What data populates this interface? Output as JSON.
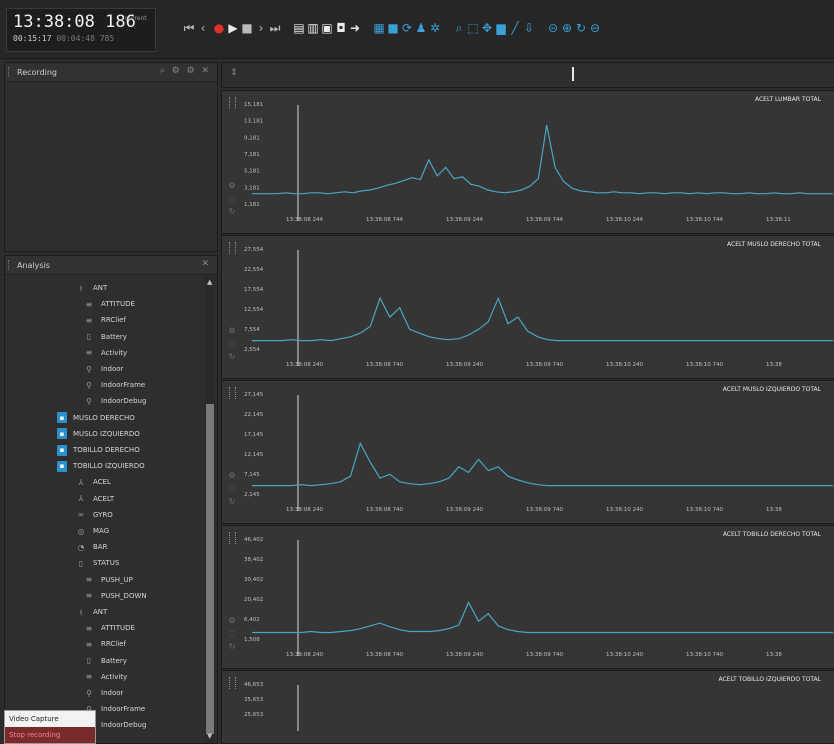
{
  "toolbar": {
    "time_main": "13:38:08 186",
    "time_tag": "current",
    "time_sub": "00:15:17",
    "time_sub_dim": "00:04:48 785",
    "buttons": [
      {
        "name": "skip-start-icon",
        "glyph": "⏮"
      },
      {
        "name": "step-back-icon",
        "glyph": "‹"
      },
      {
        "name": "record-icon",
        "glyph": "●"
      },
      {
        "name": "play-icon",
        "glyph": "▶"
      },
      {
        "name": "stop-icon",
        "glyph": "■"
      },
      {
        "name": "step-forward-icon",
        "glyph": "›"
      },
      {
        "name": "skip-end-icon",
        "glyph": "⏭"
      },
      {
        "name": "page-icon",
        "glyph": "▤"
      },
      {
        "name": "page-copy-icon",
        "glyph": "▥"
      },
      {
        "name": "save-icon",
        "glyph": "▣"
      },
      {
        "name": "camera-icon",
        "glyph": "◘"
      },
      {
        "name": "export-icon",
        "glyph": "➜"
      },
      {
        "name": "grid-icon",
        "glyph": "▦"
      },
      {
        "name": "video-icon",
        "glyph": "■"
      },
      {
        "name": "sync-icon",
        "glyph": "⟳"
      },
      {
        "name": "people-icon",
        "glyph": "♟"
      },
      {
        "name": "settings-icon",
        "glyph": "✲"
      },
      {
        "name": "zoom-icon",
        "glyph": "⌕"
      },
      {
        "name": "select-box-icon",
        "glyph": "⬚"
      },
      {
        "name": "move-icon",
        "glyph": "✥"
      },
      {
        "name": "fill-icon",
        "glyph": "▆"
      },
      {
        "name": "draw-line-icon",
        "glyph": "╱"
      },
      {
        "name": "pin-icon",
        "glyph": "⇩"
      },
      {
        "name": "zoom-fit-icon",
        "glyph": "⊝"
      },
      {
        "name": "zoom-in-icon",
        "glyph": "⊕"
      },
      {
        "name": "reset-icon",
        "glyph": "↻"
      },
      {
        "name": "zoom-out-icon",
        "glyph": "⊖"
      }
    ]
  },
  "recording_panel": {
    "title": "Recording",
    "icons": "⌕ ⚙ ⚙ ✕"
  },
  "analysis_panel": {
    "title": "Analysis",
    "close": "✕",
    "items": [
      {
        "label": "ANT",
        "icon": "ant-icon",
        "glyph": "ᚼ",
        "indent": 70,
        "badge": false
      },
      {
        "label": "ATTITUDE",
        "icon": "dot-icon",
        "glyph": "≡",
        "indent": 78,
        "badge": false
      },
      {
        "label": "RRClief",
        "icon": "dot-icon",
        "glyph": "≡",
        "indent": 78,
        "badge": false
      },
      {
        "label": "Battery",
        "icon": "battery-icon",
        "glyph": "▯",
        "indent": 78,
        "badge": false
      },
      {
        "label": "Activity",
        "icon": "dot-icon",
        "glyph": "≡",
        "indent": 78,
        "badge": false
      },
      {
        "label": "Indoor",
        "icon": "location-icon",
        "glyph": "⚲",
        "indent": 78,
        "badge": false
      },
      {
        "label": "IndoorFrame",
        "icon": "location-icon",
        "glyph": "⚲",
        "indent": 78,
        "badge": false
      },
      {
        "label": "IndoorDebug",
        "icon": "location-icon",
        "glyph": "⚲",
        "indent": 78,
        "badge": false
      },
      {
        "label": "MUSLO DERECHO",
        "icon": "sensor-badge-icon",
        "glyph": "▪",
        "indent": 52,
        "badge": true
      },
      {
        "label": "MUSLO IZQUIERDO",
        "icon": "sensor-badge-icon",
        "glyph": "▪",
        "indent": 52,
        "badge": true
      },
      {
        "label": "TOBILLO DERECHO",
        "icon": "sensor-badge-icon",
        "glyph": "▪",
        "indent": 52,
        "badge": true
      },
      {
        "label": "TOBILLO IZQUIERDO",
        "icon": "sensor-badge-icon",
        "glyph": "▪",
        "indent": 52,
        "badge": true
      },
      {
        "label": "ACEL",
        "icon": "axes-icon",
        "glyph": "⅄",
        "indent": 70,
        "badge": false
      },
      {
        "label": "ACELT",
        "icon": "axes-icon",
        "glyph": "⅄",
        "indent": 70,
        "badge": false
      },
      {
        "label": "GYRO",
        "icon": "gyro-icon",
        "glyph": "∞",
        "indent": 70,
        "badge": false
      },
      {
        "label": "MAG",
        "icon": "compass-icon",
        "glyph": "◎",
        "indent": 70,
        "badge": false
      },
      {
        "label": "BAR",
        "icon": "gauge-icon",
        "glyph": "◔",
        "indent": 70,
        "badge": false
      },
      {
        "label": "STATUS",
        "icon": "battery-icon",
        "glyph": "▯",
        "indent": 70,
        "badge": false
      },
      {
        "label": "PUSH_UP",
        "icon": "dot-icon",
        "glyph": "≡",
        "indent": 78,
        "badge": false
      },
      {
        "label": "PUSH_DOWN",
        "icon": "dot-icon",
        "glyph": "≡",
        "indent": 78,
        "badge": false
      },
      {
        "label": "ANT",
        "icon": "ant-icon",
        "glyph": "ᚼ",
        "indent": 70,
        "badge": false
      },
      {
        "label": "ATTITUDE",
        "icon": "dot-icon",
        "glyph": "≡",
        "indent": 78,
        "badge": false
      },
      {
        "label": "RRClief",
        "icon": "dot-icon",
        "glyph": "≡",
        "indent": 78,
        "badge": false
      },
      {
        "label": "Battery",
        "icon": "battery-icon",
        "glyph": "▯",
        "indent": 78,
        "badge": false
      },
      {
        "label": "Activity",
        "icon": "dot-icon",
        "glyph": "≡",
        "indent": 78,
        "badge": false
      },
      {
        "label": "Indoor",
        "icon": "location-icon",
        "glyph": "⚲",
        "indent": 78,
        "badge": false
      },
      {
        "label": "IndoorFrame",
        "icon": "location-icon",
        "glyph": "⚲",
        "indent": 78,
        "badge": false
      },
      {
        "label": "IndoorDebug",
        "icon": "location-icon",
        "glyph": "⚲",
        "indent": 78,
        "badge": false
      }
    ]
  },
  "context_menu": {
    "items": [
      "Video Capture",
      "Stop recording"
    ]
  },
  "timeline": {
    "icon": "⇕"
  },
  "chart_data": [
    {
      "type": "line",
      "title": "ACELT LUMBAR TOTAL",
      "ytick_labels": [
        "15,181",
        "13,181",
        "9,181",
        "7,181",
        "5,181",
        "3,181",
        "1,181"
      ],
      "xtick_labels": [
        "13:38:08 244",
        "13:38:08 744",
        "13:38:09 244",
        "13:38:09 744",
        "13:38:10 244",
        "13:38:10 744",
        "13:38:11"
      ],
      "color": "#4aa5c4",
      "series": [
        {
          "values": [
            0.12,
            0.12,
            0.12,
            0.12,
            0.13,
            0.12,
            0.12,
            0.13,
            0.13,
            0.12,
            0.13,
            0.14,
            0.13,
            0.15,
            0.16,
            0.18,
            0.21,
            0.23,
            0.26,
            0.29,
            0.27,
            0.48,
            0.31,
            0.4,
            0.28,
            0.3,
            0.22,
            0.2,
            0.16,
            0.14,
            0.13,
            0.14,
            0.16,
            0.2,
            0.28,
            0.85,
            0.4,
            0.25,
            0.18,
            0.15,
            0.14,
            0.13,
            0.13,
            0.14,
            0.13,
            0.13,
            0.12,
            0.13,
            0.13,
            0.12,
            0.13,
            0.13,
            0.12,
            0.13,
            0.12,
            0.13,
            0.13,
            0.12,
            0.12,
            0.13,
            0.12,
            0.12,
            0.13,
            0.12,
            0.12,
            0.13,
            0.12,
            0.12,
            0.12,
            0.12
          ]
        }
      ]
    },
    {
      "type": "line",
      "title": "ACELT MUSLO DERECHO TOTAL",
      "ytick_labels": [
        "27,554",
        "22,554",
        "17,554",
        "12,554",
        "7,554",
        "2,554"
      ],
      "xtick_labels": [
        "13:38:08 240",
        "13:38:08 740",
        "13:38:09 240",
        "13:38:09 740",
        "13:38:10 240",
        "13:38:10 740",
        "13:38"
      ],
      "color": "#4aa5c4",
      "series": [
        {
          "values": [
            0.1,
            0.1,
            0.1,
            0.1,
            0.11,
            0.1,
            0.1,
            0.11,
            0.1,
            0.12,
            0.14,
            0.18,
            0.25,
            0.55,
            0.35,
            0.45,
            0.22,
            0.18,
            0.14,
            0.12,
            0.11,
            0.12,
            0.16,
            0.22,
            0.3,
            0.55,
            0.28,
            0.35,
            0.2,
            0.14,
            0.11,
            0.1,
            0.1,
            0.1,
            0.1,
            0.1,
            0.1,
            0.1,
            0.1,
            0.1,
            0.1,
            0.1,
            0.1,
            0.1,
            0.1,
            0.1,
            0.1,
            0.1,
            0.1,
            0.1,
            0.1,
            0.1,
            0.1,
            0.1,
            0.1,
            0.1,
            0.1,
            0.1,
            0.1,
            0.1
          ]
        }
      ]
    },
    {
      "type": "line",
      "title": "ACELT MUSLO IZQUIERDO TOTAL",
      "ytick_labels": [
        "27,145",
        "22,145",
        "17,145",
        "12,145",
        "7,145",
        "2,145"
      ],
      "xtick_labels": [
        "13:38:08 240",
        "13:38:08 740",
        "13:38:09 240",
        "13:38:09 740",
        "13:38:10 240",
        "13:38:10 740",
        "13:38"
      ],
      "color": "#4aa5c4",
      "series": [
        {
          "values": [
            0.1,
            0.1,
            0.1,
            0.1,
            0.1,
            0.11,
            0.1,
            0.11,
            0.12,
            0.14,
            0.2,
            0.55,
            0.35,
            0.18,
            0.22,
            0.14,
            0.12,
            0.11,
            0.12,
            0.14,
            0.18,
            0.3,
            0.24,
            0.38,
            0.26,
            0.3,
            0.2,
            0.16,
            0.13,
            0.11,
            0.1,
            0.1,
            0.1,
            0.1,
            0.1,
            0.1,
            0.1,
            0.1,
            0.1,
            0.1,
            0.1,
            0.1,
            0.1,
            0.1,
            0.1,
            0.1,
            0.1,
            0.1,
            0.1,
            0.1,
            0.1,
            0.1,
            0.1,
            0.1,
            0.1,
            0.1,
            0.1,
            0.1,
            0.1,
            0.1
          ]
        }
      ]
    },
    {
      "type": "line",
      "title": "ACELT TOBILLO DERECHO TOTAL",
      "ytick_labels": [
        "46,402",
        "38,402",
        "30,402",
        "20,402",
        "6,402",
        "1,508"
      ],
      "xtick_labels": [
        "13:38:08 240",
        "13:38:08 740",
        "13:38:09 240",
        "13:38:09 740",
        "13:38:10 240",
        "13:38:10 740",
        "13:38"
      ],
      "color": "#4aa5c4",
      "series": [
        {
          "values": [
            0.08,
            0.08,
            0.08,
            0.08,
            0.08,
            0.08,
            0.09,
            0.08,
            0.08,
            0.09,
            0.1,
            0.12,
            0.15,
            0.18,
            0.14,
            0.11,
            0.09,
            0.09,
            0.09,
            0.1,
            0.12,
            0.16,
            0.4,
            0.2,
            0.28,
            0.15,
            0.11,
            0.09,
            0.08,
            0.08,
            0.08,
            0.08,
            0.08,
            0.08,
            0.08,
            0.08,
            0.08,
            0.08,
            0.08,
            0.08,
            0.08,
            0.08,
            0.08,
            0.08,
            0.08,
            0.08,
            0.08,
            0.08,
            0.08,
            0.08,
            0.08,
            0.08,
            0.08,
            0.08,
            0.08,
            0.08,
            0.08,
            0.08,
            0.08,
            0.08
          ]
        }
      ]
    },
    {
      "type": "line",
      "title": "ACELT TOBILLO IZQUIERDO TOTAL",
      "ytick_labels": [
        "46,653",
        "35,653",
        "25,653"
      ],
      "xtick_labels": [],
      "color": "#4aa5c4",
      "series": [
        {
          "values": []
        }
      ]
    }
  ]
}
